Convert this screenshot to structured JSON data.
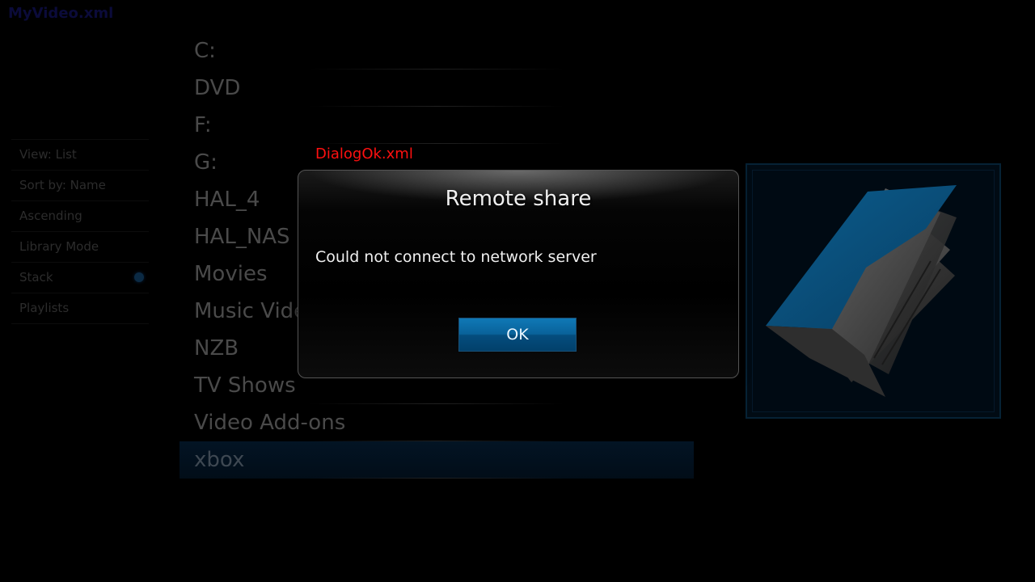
{
  "window_label": "MyVideo.xml",
  "options": [
    {
      "label": "View: List"
    },
    {
      "label": "Sort by: Name"
    },
    {
      "label": "Ascending"
    },
    {
      "label": "Library Mode"
    },
    {
      "label": "Stack",
      "toggle": true
    },
    {
      "label": "Playlists"
    }
  ],
  "list": {
    "items": [
      "C:",
      "DVD",
      "F:",
      "G:",
      "HAL_4",
      "HAL_NAS",
      "Movies",
      "Music Videos",
      "NZB",
      "TV Shows",
      "Video Add-ons",
      "xbox"
    ],
    "selected_index": 11
  },
  "thumbnail": {
    "icon": "folder-icon"
  },
  "dialog": {
    "label": "DialogOk.xml",
    "title": "Remote share",
    "message": "Could not connect to network server",
    "ok_label": "OK"
  }
}
